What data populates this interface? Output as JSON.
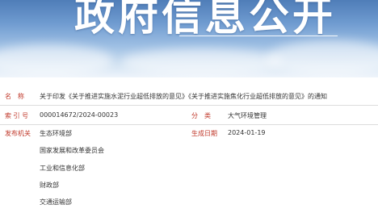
{
  "banner": {
    "title": "政府信息公开"
  },
  "info": {
    "name_label": "名　称",
    "name_value": "关于印发《关于推进实施水泥行业超低排放的意见》《关于推进实施焦化行业超低排放的意见》的通知",
    "index_label": "索 引 号",
    "index_value": "000014672/2024-00023",
    "category_label": "分　类",
    "category_value": "大气环境管理",
    "issuer_label": "发布机关",
    "issuers": [
      "生态环境部",
      "国家发展和改革委员会",
      "工业和信息化部",
      "财政部",
      "交通运输部"
    ],
    "date_label": "生成日期",
    "date_value": "2024-01-19"
  }
}
